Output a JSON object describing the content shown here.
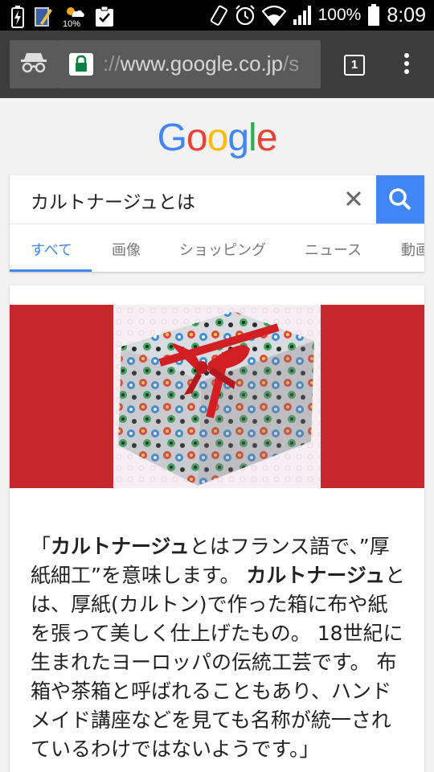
{
  "status_bar": {
    "time": "8:09",
    "battery_percent": "100%",
    "weather_percent": "10%"
  },
  "browser": {
    "url_prefix": "://",
    "url_host": "www.google.co.jp",
    "url_suffix": "/s",
    "tab_count": "1"
  },
  "google": {
    "logo": [
      "G",
      "o",
      "o",
      "g",
      "l",
      "e"
    ],
    "logo_colors": [
      "#4285f4",
      "#ea4335",
      "#fbbc05",
      "#4285f4",
      "#34a853",
      "#ea4335"
    ]
  },
  "search": {
    "query": "カルトナージュとは"
  },
  "tabs": [
    "すべて",
    "画像",
    "ショッピング",
    "ニュース",
    "動画"
  ],
  "result": {
    "snippet": [
      {
        "text": "「",
        "bold": false
      },
      {
        "text": "カルトナージュ",
        "bold": true
      },
      {
        "text": "とはフランス語で、”厚紙細工”を意味します。 ",
        "bold": false
      },
      {
        "text": "カルトナージュ",
        "bold": true
      },
      {
        "text": "とは、厚紙(カルトン)で作った箱に布や紙を張って美しく仕上げたもの。 18世紀に生まれたヨーロッパの伝統工芸です。 布箱や茶箱と呼ばれることもあり、ハンドメイド講座などを見ても名称が統一されているわけではないようです。」",
        "bold": false
      }
    ]
  },
  "colors": {
    "accent": "#4285f4",
    "banner": "#c5282b",
    "toolbar": "#3c3c3c"
  }
}
